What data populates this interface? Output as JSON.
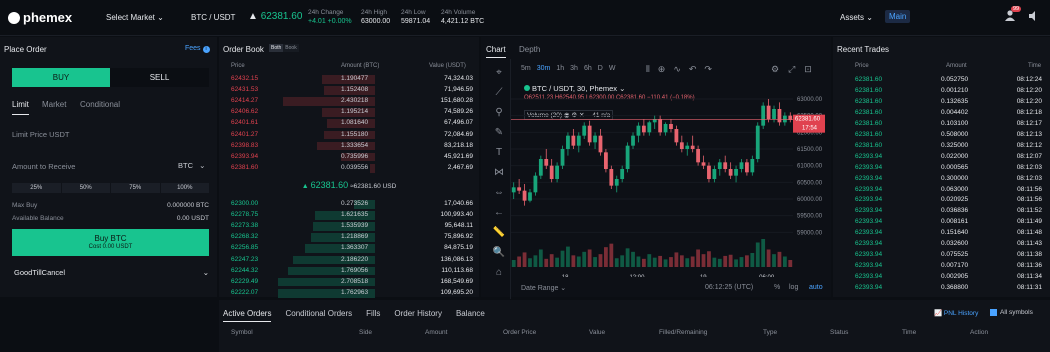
{
  "app": {
    "logo": "phemex"
  },
  "topbar": {
    "select_market": "Select Market",
    "symbol": "BTC / USDT",
    "last_price": "62381.60",
    "stats": [
      {
        "label": "24h Change",
        "value": "+4.01 +0.00%",
        "green": true
      },
      {
        "label": "24h High",
        "value": "63000.00"
      },
      {
        "label": "24h Low",
        "value": "59871.04"
      },
      {
        "label": "24h Volume",
        "value": "4,421.12 BTC"
      }
    ],
    "assets": "Assets",
    "main": "Main",
    "badge": "99"
  },
  "place_order": {
    "title": "Place Order",
    "fees": "Fees",
    "buy": "BUY",
    "sell": "SELL",
    "tabs": [
      "Limit",
      "Market",
      "Conditional"
    ],
    "limit_price": "Limit Price USDT",
    "amount_label": "Amount to Receive",
    "amount_unit": "BTC",
    "percents": [
      "25%",
      "50%",
      "75%",
      "100%"
    ],
    "max_buy_label": "Max Buy",
    "max_buy_value": "0.000000 BTC",
    "avail_label": "Available Balance",
    "avail_value": "0.00 USDT",
    "buy_btn": "Buy BTC",
    "cost": "Cost 0.00 USDT",
    "tif": "GoodTillCancel"
  },
  "order_book": {
    "title": "Order Book",
    "toggle": [
      "Both",
      "Book"
    ],
    "headers": [
      "Price",
      "Amount (BTC)",
      "Value (USDT)"
    ],
    "asks": [
      [
        "62432.15",
        "1.190477",
        "74,324.03"
      ],
      [
        "62431.53",
        "1.152408",
        "71,946.59"
      ],
      [
        "62414.27",
        "2.430218",
        "151,680.28"
      ],
      [
        "62406.62",
        "1.195214",
        "74,589.26"
      ],
      [
        "62401.61",
        "1.081640",
        "67,496.07"
      ],
      [
        "62401.27",
        "1.155180",
        "72,084.69"
      ],
      [
        "62398.83",
        "1.333654",
        "83,218.18"
      ],
      [
        "62393.94",
        "0.735996",
        "45,921.69"
      ],
      [
        "62381.60",
        "0.039556",
        "2,467.69"
      ]
    ],
    "ask_depth": [
      0.55,
      0.53,
      0.95,
      0.55,
      0.5,
      0.53,
      0.6,
      0.35,
      0.05
    ],
    "mid_price": "62381.60",
    "mid_usd": "≈62381.60 USD",
    "bids": [
      [
        "62300.00",
        "0.273526",
        "17,040.66"
      ],
      [
        "62278.75",
        "1.621635",
        "100,993.40"
      ],
      [
        "62273.38",
        "1.535939",
        "95,648.11"
      ],
      [
        "62268.32",
        "1.218869",
        "75,896.92"
      ],
      [
        "62256.85",
        "1.363307",
        "84,875.19"
      ],
      [
        "62247.23",
        "2.186220",
        "136,086.13"
      ],
      [
        "62244.32",
        "1.769056",
        "110,113.68"
      ],
      [
        "62229.49",
        "2.708518",
        "168,549.69"
      ],
      [
        "62222.07",
        "1.762963",
        "109,695.20"
      ]
    ],
    "bid_depth": [
      0.22,
      0.62,
      0.64,
      0.66,
      0.72,
      0.85,
      0.9,
      1.0,
      1.0
    ]
  },
  "chart": {
    "tabs": [
      "Chart",
      "Depth"
    ],
    "intervals": [
      "5m",
      "30m",
      "1h",
      "3h",
      "6h",
      "D",
      "W"
    ],
    "title": "BTC / USDT, 30, Phemex",
    "ohlc": "O62511.23 H62540.95 L62300.00 C62381.60 −110.41 (−0.18%)",
    "volume": "Volume (20)",
    "vol_value": "41 n/a",
    "price_tag": "62381.60",
    "time_tag": "17:54",
    "y_ticks": [
      "63000.00",
      "62500.00",
      "62000.00",
      "61500.00",
      "61000.00",
      "60500.00",
      "60000.00",
      "59500.00",
      "59000.00"
    ],
    "x_ticks": [
      "18",
      "12:00",
      "19",
      "06:00"
    ],
    "date_range": "Date Range",
    "clock": "06:12:25 (UTC)",
    "pct": "%",
    "log": "log",
    "auto": "auto",
    "accent": "#4aa3ff",
    "up_color": "#18a57a",
    "down_color": "#e8646f"
  },
  "chart_data": {
    "type": "candlestick",
    "ylim": [
      58800,
      63300
    ],
    "candles": [
      [
        60200,
        60500,
        60000,
        60350
      ],
      [
        60350,
        60600,
        60150,
        60250
      ],
      [
        60250,
        60450,
        59800,
        59950
      ],
      [
        59950,
        60300,
        59900,
        60200
      ],
      [
        60200,
        60800,
        60100,
        60700
      ],
      [
        60700,
        61300,
        60600,
        61200
      ],
      [
        61200,
        61500,
        60900,
        61000
      ],
      [
        61000,
        61200,
        60500,
        60600
      ],
      [
        60600,
        61100,
        60500,
        61000
      ],
      [
        61000,
        61600,
        60900,
        61500
      ],
      [
        61500,
        62000,
        61300,
        61900
      ],
      [
        61900,
        62100,
        61500,
        61600
      ],
      [
        61600,
        62000,
        61400,
        61900
      ],
      [
        61900,
        62300,
        61800,
        62200
      ],
      [
        62200,
        62350,
        61600,
        61700
      ],
      [
        61700,
        62000,
        61500,
        61900
      ],
      [
        61900,
        62100,
        61300,
        61400
      ],
      [
        61400,
        61500,
        60800,
        60900
      ],
      [
        60900,
        61000,
        60300,
        60400
      ],
      [
        60400,
        60700,
        60200,
        60600
      ],
      [
        60600,
        61000,
        60500,
        60900
      ],
      [
        60900,
        61700,
        60800,
        61600
      ],
      [
        61600,
        62000,
        61500,
        61900
      ],
      [
        61900,
        62300,
        61700,
        62200
      ],
      [
        62200,
        62400,
        61900,
        62000
      ],
      [
        62000,
        62350,
        61900,
        62300
      ],
      [
        62300,
        62500,
        62100,
        62400
      ],
      [
        62400,
        62500,
        61900,
        62000
      ],
      [
        62000,
        62300,
        61900,
        62250
      ],
      [
        62250,
        62400,
        62000,
        62100
      ],
      [
        62100,
        62200,
        61600,
        61700
      ],
      [
        61700,
        61900,
        61400,
        61500
      ],
      [
        61500,
        61700,
        61300,
        61600
      ],
      [
        61600,
        61900,
        61400,
        61500
      ],
      [
        61500,
        61600,
        61000,
        61100
      ],
      [
        61100,
        61300,
        60900,
        61000
      ],
      [
        61000,
        61100,
        60500,
        60600
      ],
      [
        60600,
        61000,
        60500,
        60900
      ],
      [
        60900,
        61200,
        60700,
        61100
      ],
      [
        61100,
        61300,
        60800,
        60900
      ],
      [
        60900,
        61100,
        60600,
        60700
      ],
      [
        60700,
        61000,
        60500,
        60900
      ],
      [
        60900,
        61200,
        60800,
        61100
      ],
      [
        61100,
        61200,
        60700,
        60800
      ],
      [
        60800,
        61300,
        60700,
        61200
      ],
      [
        61200,
        62300,
        61100,
        62200
      ],
      [
        62200,
        62900,
        62100,
        62800
      ],
      [
        62800,
        63000,
        62300,
        62400
      ],
      [
        62400,
        62800,
        62300,
        62700
      ],
      [
        62700,
        62900,
        62200,
        62300
      ],
      [
        62300,
        62600,
        62200,
        62500
      ],
      [
        62500,
        62600,
        62300,
        62380
      ]
    ],
    "volumes": [
      12,
      18,
      25,
      15,
      20,
      30,
      14,
      22,
      16,
      28,
      35,
      20,
      18,
      26,
      30,
      17,
      22,
      34,
      40,
      15,
      20,
      32,
      26,
      18,
      14,
      22,
      16,
      19,
      13,
      17,
      25,
      20,
      15,
      18,
      30,
      22,
      27,
      16,
      14,
      19,
      21,
      13,
      17,
      20,
      24,
      42,
      48,
      30,
      22,
      26,
      18,
      12
    ]
  },
  "recent_trades": {
    "title": "Recent Trades",
    "headers": [
      "Price",
      "Amount",
      "Time"
    ],
    "rows": [
      [
        "62381.60",
        "0.052750",
        "08:12:24"
      ],
      [
        "62381.60",
        "0.001210",
        "08:12:20"
      ],
      [
        "62381.60",
        "0.132635",
        "08:12:20"
      ],
      [
        "62381.60",
        "0.004402",
        "08:12:18"
      ],
      [
        "62381.60",
        "0.103100",
        "08:12:17"
      ],
      [
        "62381.60",
        "0.508000",
        "08:12:13"
      ],
      [
        "62381.60",
        "0.325000",
        "08:12:12"
      ],
      [
        "62393.94",
        "0.022000",
        "08:12:07"
      ],
      [
        "62393.94",
        "0.000565",
        "08:12:03"
      ],
      [
        "62393.94",
        "0.300000",
        "08:12:03"
      ],
      [
        "62393.94",
        "0.063000",
        "08:11:56"
      ],
      [
        "62393.94",
        "0.020925",
        "08:11:56"
      ],
      [
        "62393.94",
        "0.036836",
        "08:11:52"
      ],
      [
        "62393.94",
        "0.008161",
        "08:11:49"
      ],
      [
        "62393.94",
        "0.151640",
        "08:11:48"
      ],
      [
        "62393.94",
        "0.032600",
        "08:11:43"
      ],
      [
        "62393.94",
        "0.075525",
        "08:11:38"
      ],
      [
        "62393.94",
        "0.007170",
        "08:11:36"
      ],
      [
        "62393.94",
        "0.002905",
        "08:11:34"
      ],
      [
        "62393.94",
        "0.368800",
        "08:11:31"
      ]
    ]
  },
  "orders": {
    "tabs": [
      "Active Orders",
      "Conditional Orders",
      "Fills",
      "Order History",
      "Balance"
    ],
    "pnl": "PNL History",
    "all_symbols": "All symbols",
    "columns": [
      "Symbol",
      "Side",
      "Amount",
      "Order Price",
      "Value",
      "Filled/Remaining",
      "Type",
      "Status",
      "Time",
      "Action"
    ]
  }
}
